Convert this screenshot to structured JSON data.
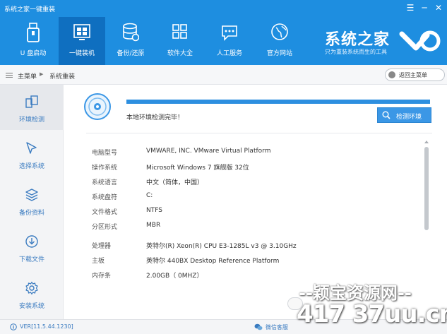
{
  "window": {
    "title": "系统之家一键重装",
    "controls": [
      "menu-icon",
      "minimize-icon",
      "close-icon"
    ]
  },
  "nav": {
    "items": [
      {
        "label": "U 盘启动",
        "icon": "usb-drive-icon"
      },
      {
        "label": "一键装机",
        "icon": "windows-logo-icon",
        "active": true
      },
      {
        "label": "备份/还原",
        "icon": "database-restore-icon"
      },
      {
        "label": "软件大全",
        "icon": "app-grid-icon"
      },
      {
        "label": "人工服务",
        "icon": "chat-bubble-icon"
      },
      {
        "label": "官方网站",
        "icon": "globe-icon"
      }
    ]
  },
  "brand": {
    "name": "系统之家",
    "tagline": "只为重装系统而生的工具"
  },
  "breadcrumb": {
    "home": "主菜单",
    "current": "系统重装",
    "back_label": "返回主菜单"
  },
  "sidebar": {
    "items": [
      {
        "label": "环境检测",
        "icon": "environment-check-icon",
        "active": true
      },
      {
        "label": "选择系统",
        "icon": "cursor-select-icon"
      },
      {
        "label": "备份资料",
        "icon": "layers-backup-icon"
      },
      {
        "label": "下载文件",
        "icon": "download-icon"
      },
      {
        "label": "安装系统",
        "icon": "gear-install-icon"
      }
    ]
  },
  "detection": {
    "status": "本地环境检测完毕！",
    "progress": 1.0,
    "button_label": "检测环境"
  },
  "info": {
    "rows": [
      {
        "key": "电脑型号",
        "value": "VMWARE, INC. VMware Virtual Platform"
      },
      {
        "key": "操作系统",
        "value": "Microsoft Windows 7 旗舰版  32位"
      },
      {
        "key": "系统语言",
        "value": "中文（简体，中国）"
      },
      {
        "key": "系统盘符",
        "value": "C:"
      },
      {
        "key": "文件格式",
        "value": "NTFS"
      },
      {
        "key": "分区形式",
        "value": "MBR"
      },
      {
        "key": "处理器",
        "value": "英特尔(R) Xeon(R) CPU E3-1285L v3 @ 3.10GHz"
      },
      {
        "key": "主板",
        "value": "英特尔 440BX Desktop Reference Platform"
      },
      {
        "key": "内存条",
        "value": "2.00GB（ 0MHZ）"
      }
    ]
  },
  "footer": {
    "version": "VER[11.5.44.1230]",
    "wechat": "微信客服"
  },
  "watermark": {
    "line1": "--颖宝资源网--",
    "line2": "417 37uu.cn"
  },
  "colors": {
    "primary_blue": "#1e8ee0",
    "active_nav": "#0f6fc0",
    "accent_text": "#3a7bc0"
  }
}
